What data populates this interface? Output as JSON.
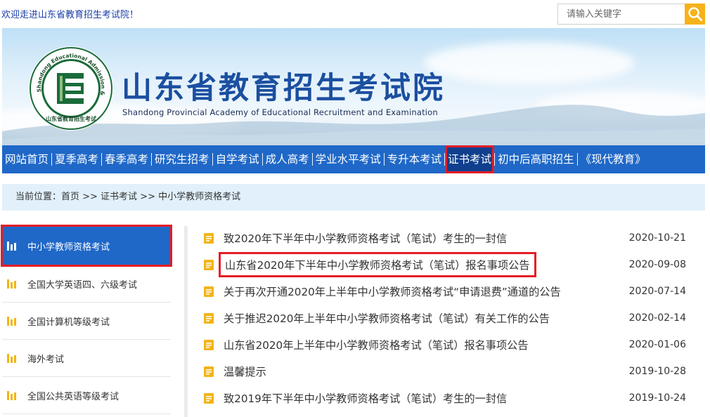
{
  "header": {
    "welcome": "欢迎走进山东省教育招生考试院！",
    "search_placeholder": "请输入关键字"
  },
  "banner": {
    "logo_ring_text": "Shandong Educational Admission & Examinations",
    "logo_bottom_text": "山东省教育招生考试",
    "logo_letter": "E",
    "title_cn": "山东省教育招生考试院",
    "title_en": "Shandong Provincial Academy of Educational Recruitment and Examination"
  },
  "nav": {
    "items": [
      {
        "label": "网站首页"
      },
      {
        "label": "夏季高考"
      },
      {
        "label": "春季高考"
      },
      {
        "label": "研究生招考"
      },
      {
        "label": "自学考试"
      },
      {
        "label": "成人高考"
      },
      {
        "label": "学业水平考试"
      },
      {
        "label": "专升本考试"
      },
      {
        "label": "证书考试",
        "active": true
      },
      {
        "label": "初中后高职招生"
      },
      {
        "label": "《现代教育》"
      }
    ]
  },
  "breadcrumb": "当前位置：首页 >> 证书考试 >> 中小学教师资格考试",
  "sidebar": {
    "items": [
      {
        "label": "中小学教师资格考试",
        "active": true
      },
      {
        "label": "全国大学英语四、六级考试"
      },
      {
        "label": "全国计算机等级考试"
      },
      {
        "label": "海外考试"
      },
      {
        "label": "全国公共英语等级考试"
      }
    ]
  },
  "articles": [
    {
      "title": "致2020年下半年中小学教师资格考试（笔试）考生的一封信",
      "date": "2020-10-21"
    },
    {
      "title": "山东省2020年下半年中小学教师资格考试（笔试）报名事项公告",
      "date": "2020-09-08",
      "highlight": true
    },
    {
      "title": "关于再次开通2020年上半年中小学教师资格考试“申请退费”通道的公告",
      "date": "2020-07-14"
    },
    {
      "title": "关于推迟2020年上半年中小学教师资格考试（笔试）有关工作的公告",
      "date": "2020-02-14"
    },
    {
      "title": "山东省2020年上半年中小学教师资格考试（笔试）报名事项公告",
      "date": "2020-01-06"
    },
    {
      "title": "温馨提示",
      "date": "2019-10-28"
    },
    {
      "title": "致2019年下半年中小学教师资格考试（笔试）考生的一封信",
      "date": "2019-10-24"
    }
  ],
  "colors": {
    "nav_blue": "#1f68c8",
    "highlight_red": "#e51d24",
    "icon_yellow": "#f2b416",
    "search_button": "#f6b21a"
  }
}
